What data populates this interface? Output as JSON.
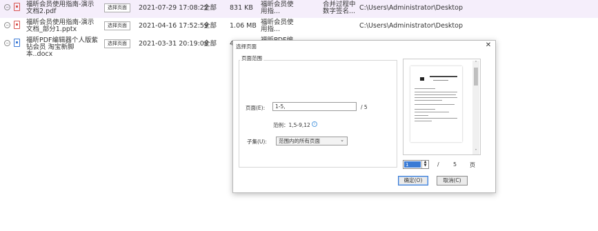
{
  "file_list": {
    "rows": [
      {
        "name": "福昕会员使用指南-演示文档2.pdf",
        "type": "pdf",
        "select_label": "选择页面",
        "modified": "2021-07-29 17:08:22",
        "page_range": "全部",
        "size": "831 KB",
        "title": "福昕会员使用指...",
        "subject": "合并过程中数字签名...",
        "path": "C:\\Users\\Administrator\\Desktop",
        "selected": true
      },
      {
        "name": "福昕会员使用指南-演示文档_部分1.pptx",
        "type": "pdf",
        "select_label": "选择页面",
        "modified": "2021-04-16 17:52:59",
        "page_range": "全部",
        "size": "1.06 MB",
        "title": "福昕会员使用指...",
        "subject": "",
        "path": "C:\\Users\\Administrator\\Desktop",
        "selected": false
      },
      {
        "name": "福昕PDF编辑器个人版紫钻会员 淘宝新脚本..docx",
        "type": "word",
        "select_label": "选择页面",
        "modified": "2021-03-31 20:19:08",
        "page_range": "全部",
        "size": "4",
        "title": "福昕PDF编",
        "subject": "",
        "path": "",
        "selected": false
      }
    ]
  },
  "dialog": {
    "title": "选择页面",
    "close_icon": "close-icon",
    "group_title": "页面范围",
    "pages_label": "页面(E):",
    "pages_value": "1-5,",
    "total_pages": "/ 5",
    "example": "范例：1,5-9,12",
    "subset_label": "子集(U):",
    "subset_value": "范围内的所有页面",
    "preview": {
      "current_page": "1",
      "slash": "/",
      "total": "5",
      "unit": "页"
    },
    "ok_label": "确定(O)",
    "cancel_label": "取消(C)"
  },
  "colors": {
    "selected_row": "#f5eefb",
    "accent": "#3a7bd5",
    "pdf_icon": "#d9534f",
    "word_icon": "#3a78d6"
  }
}
